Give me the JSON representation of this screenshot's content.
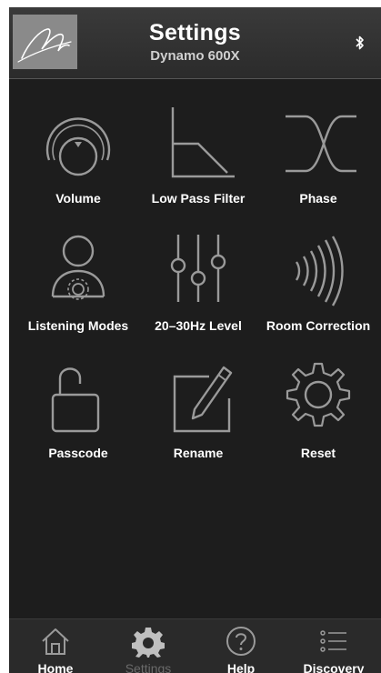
{
  "header": {
    "title": "Settings",
    "subtitle": "Dynamo 600X",
    "logo_icon": "signature-logo-icon",
    "bluetooth_icon": "bluetooth-icon"
  },
  "tiles": [
    {
      "label": "Volume",
      "icon": "volume-dial-icon"
    },
    {
      "label": "Low Pass Filter",
      "icon": "low-pass-filter-icon"
    },
    {
      "label": "Phase",
      "icon": "phase-icon"
    },
    {
      "label": "Listening Modes",
      "icon": "listening-modes-icon"
    },
    {
      "label": "20–30Hz Level",
      "icon": "sliders-icon"
    },
    {
      "label": "Room Correction",
      "icon": "room-correction-icon"
    },
    {
      "label": "Passcode",
      "icon": "padlock-icon"
    },
    {
      "label": "Rename",
      "icon": "rename-pencil-icon"
    },
    {
      "label": "Reset",
      "icon": "gear-reset-icon"
    }
  ],
  "tabbar": {
    "tabs": [
      {
        "label": "Home",
        "icon": "home-icon",
        "active": false
      },
      {
        "label": "Settings",
        "icon": "gear-icon",
        "active": true
      },
      {
        "label": "Help",
        "icon": "help-icon",
        "active": false
      },
      {
        "label": "Discovery",
        "icon": "list-icon",
        "active": false
      }
    ]
  },
  "colors": {
    "background": "#1d1d1d",
    "icon_stroke": "#9a9a9a",
    "label": "#ffffff",
    "active_tab_label": "#6a6a6a"
  }
}
